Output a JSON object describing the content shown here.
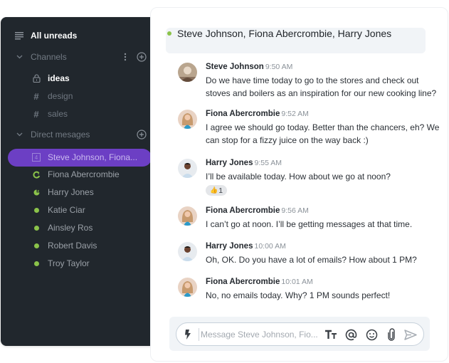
{
  "sidebar": {
    "all_unreads": {
      "label": "All unreads",
      "icon": "list-icon"
    },
    "channels_section": {
      "label": "Channels",
      "icon": "chevron-down-icon"
    },
    "channels": [
      {
        "name": "ideas",
        "icon": "lock-icon",
        "unread": true
      },
      {
        "name": "design",
        "icon": "hash-icon",
        "unread": false
      },
      {
        "name": "sales",
        "icon": "hash-icon",
        "unread": false
      }
    ],
    "dm_section": {
      "label": "Direct mesages",
      "icon": "chevron-down-icon"
    },
    "direct_messages": [
      {
        "name": "Steve Johnson, Fiona...",
        "icon": "group-count-icon",
        "badge": "4",
        "active": true
      },
      {
        "name": "Fiona Abercrombie",
        "icon": "away-status-icon",
        "status": "away"
      },
      {
        "name": "Harry Jones",
        "icon": "dnd-status-icon",
        "status": "dnd"
      },
      {
        "name": "Katie Ciar",
        "icon": "online-dot-icon",
        "status": "online"
      },
      {
        "name": "Ainsley Ros",
        "icon": "online-dot-icon",
        "status": "online"
      },
      {
        "name": "Robert Davis",
        "icon": "online-dot-icon",
        "status": "online"
      },
      {
        "name": "Troy Taylor",
        "icon": "online-dot-icon",
        "status": "online"
      }
    ]
  },
  "header": {
    "title": "Steve Johnson, Fiona Abercrombie, Harry Jones",
    "status": "online"
  },
  "messages": [
    {
      "author": "Steve Johnson",
      "time": "9:50 AM",
      "text": "Do we have time today to go to the stores and check out stoves and boilers as an inspiration for our new cooking line?"
    },
    {
      "author": "Fiona Abercrombie",
      "time": "9:52 AM",
      "text": "I agree we should go today. Better than the chancers, eh? We can stop for a fizzy juice on the way back :)"
    },
    {
      "author": "Harry Jones",
      "time": "9:55 AM",
      "text": "I’ll be available today. How about we go at noon?",
      "reaction": {
        "emoji": "👍",
        "count": "1"
      }
    },
    {
      "author": "Fiona Abercrombie",
      "time": "9:56 AM",
      "text": "I can’t go at noon. I’ll be getting messages at that time."
    },
    {
      "author": "Harry Jones",
      "time": "10:00 AM",
      "text": "Oh, OK. Do you have a lot of emails? How about 1 PM?"
    },
    {
      "author": "Fiona Abercrombie",
      "time": "10:01 AM",
      "text": "No, no emails today. Why? 1 PM sounds perfect!"
    }
  ],
  "composer": {
    "placeholder": "Message Steve Johnson, Fio...",
    "value": "",
    "icons": [
      "lightning-icon",
      "text-format-icon",
      "mention-icon",
      "emoji-icon",
      "attach-icon",
      "send-icon"
    ]
  },
  "colors": {
    "sidebar_bg": "#21272d",
    "active_item": "#6c3fc4",
    "status_green": "#8bc34a"
  }
}
